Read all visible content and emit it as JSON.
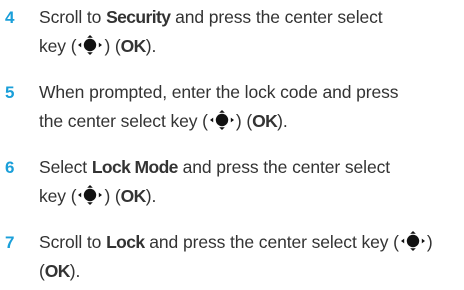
{
  "colors": {
    "step_number": "#1a9fd9",
    "text": "#333333",
    "icon": "#111111"
  },
  "icons": {
    "center_select_key": "nav-center-select-icon"
  },
  "steps": [
    {
      "number": "4",
      "t1": "Scroll to ",
      "b1": "Security",
      "t2": " and press the center select",
      "t3": "key (",
      "t4": ") (",
      "b2": "OK",
      "t5": ")."
    },
    {
      "number": "5",
      "t1": "When prompted, enter the lock code and press",
      "t2": "the center select key (",
      "t3": ") (",
      "b1": "OK",
      "t4": ")."
    },
    {
      "number": "6",
      "t1": "Select ",
      "b1": "Lock Mode",
      "t2": " and press the center select",
      "t3": "key (",
      "t4": ") (",
      "b2": "OK",
      "t5": ")."
    },
    {
      "number": "7",
      "t1": "Scroll to ",
      "b1": "Lock",
      "t2": " and press the center select key (",
      "t3": ")",
      "t4": "(",
      "b2": "OK",
      "t5": ")."
    }
  ]
}
